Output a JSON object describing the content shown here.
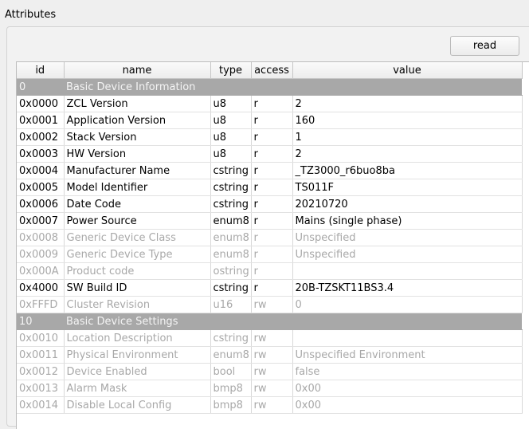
{
  "group": {
    "title": "Attributes"
  },
  "read_button": {
    "label": "read"
  },
  "table": {
    "columns": [
      "id",
      "name",
      "type",
      "access",
      "value"
    ],
    "rows": [
      {
        "kind": "section",
        "id": "0",
        "name": "Basic Device Information"
      },
      {
        "kind": "attr",
        "enabled": true,
        "id": "0x0000",
        "name": "ZCL Version",
        "type": "u8",
        "access": "r",
        "value": "2"
      },
      {
        "kind": "attr",
        "enabled": true,
        "id": "0x0001",
        "name": "Application Version",
        "type": "u8",
        "access": "r",
        "value": "160"
      },
      {
        "kind": "attr",
        "enabled": true,
        "id": "0x0002",
        "name": "Stack Version",
        "type": "u8",
        "access": "r",
        "value": "1"
      },
      {
        "kind": "attr",
        "enabled": true,
        "id": "0x0003",
        "name": "HW Version",
        "type": "u8",
        "access": "r",
        "value": "2"
      },
      {
        "kind": "attr",
        "enabled": true,
        "id": "0x0004",
        "name": "Manufacturer Name",
        "type": "cstring",
        "access": "r",
        "value": "_TZ3000_r6buo8ba"
      },
      {
        "kind": "attr",
        "enabled": true,
        "id": "0x0005",
        "name": "Model Identifier",
        "type": "cstring",
        "access": "r",
        "value": "TS011F"
      },
      {
        "kind": "attr",
        "enabled": true,
        "id": "0x0006",
        "name": "Date Code",
        "type": "cstring",
        "access": "r",
        "value": "20210720"
      },
      {
        "kind": "attr",
        "enabled": true,
        "id": "0x0007",
        "name": "Power Source",
        "type": "enum8",
        "access": "r",
        "value": "Mains (single phase)"
      },
      {
        "kind": "attr",
        "enabled": false,
        "id": "0x0008",
        "name": "Generic Device Class",
        "type": "enum8",
        "access": "r",
        "value": "Unspecified"
      },
      {
        "kind": "attr",
        "enabled": false,
        "id": "0x0009",
        "name": "Generic Device Type",
        "type": "enum8",
        "access": "r",
        "value": "Unspecified"
      },
      {
        "kind": "attr",
        "enabled": false,
        "id": "0x000A",
        "name": "Product code",
        "type": "ostring",
        "access": "r",
        "value": ""
      },
      {
        "kind": "attr",
        "enabled": true,
        "id": "0x4000",
        "name": "SW Build ID",
        "type": "cstring",
        "access": "r",
        "value": "20B-TZSKT11BS3.4"
      },
      {
        "kind": "attr",
        "enabled": false,
        "id": "0xFFFD",
        "name": "Cluster Revision",
        "type": "u16",
        "access": "rw",
        "value": "0"
      },
      {
        "kind": "section",
        "id": "10",
        "name": "Basic Device Settings"
      },
      {
        "kind": "attr",
        "enabled": false,
        "id": "0x0010",
        "name": "Location Description",
        "type": "cstring",
        "access": "rw",
        "value": ""
      },
      {
        "kind": "attr",
        "enabled": false,
        "id": "0x0011",
        "name": "Physical Environment",
        "type": "enum8",
        "access": "rw",
        "value": "Unspecified Environment"
      },
      {
        "kind": "attr",
        "enabled": false,
        "id": "0x0012",
        "name": "Device Enabled",
        "type": "bool",
        "access": "rw",
        "value": "false"
      },
      {
        "kind": "attr",
        "enabled": false,
        "id": "0x0013",
        "name": "Alarm Mask",
        "type": "bmp8",
        "access": "rw",
        "value": "0x00"
      },
      {
        "kind": "attr",
        "enabled": false,
        "id": "0x0014",
        "name": "Disable Local Config",
        "type": "bmp8",
        "access": "rw",
        "value": "0x00"
      }
    ]
  }
}
